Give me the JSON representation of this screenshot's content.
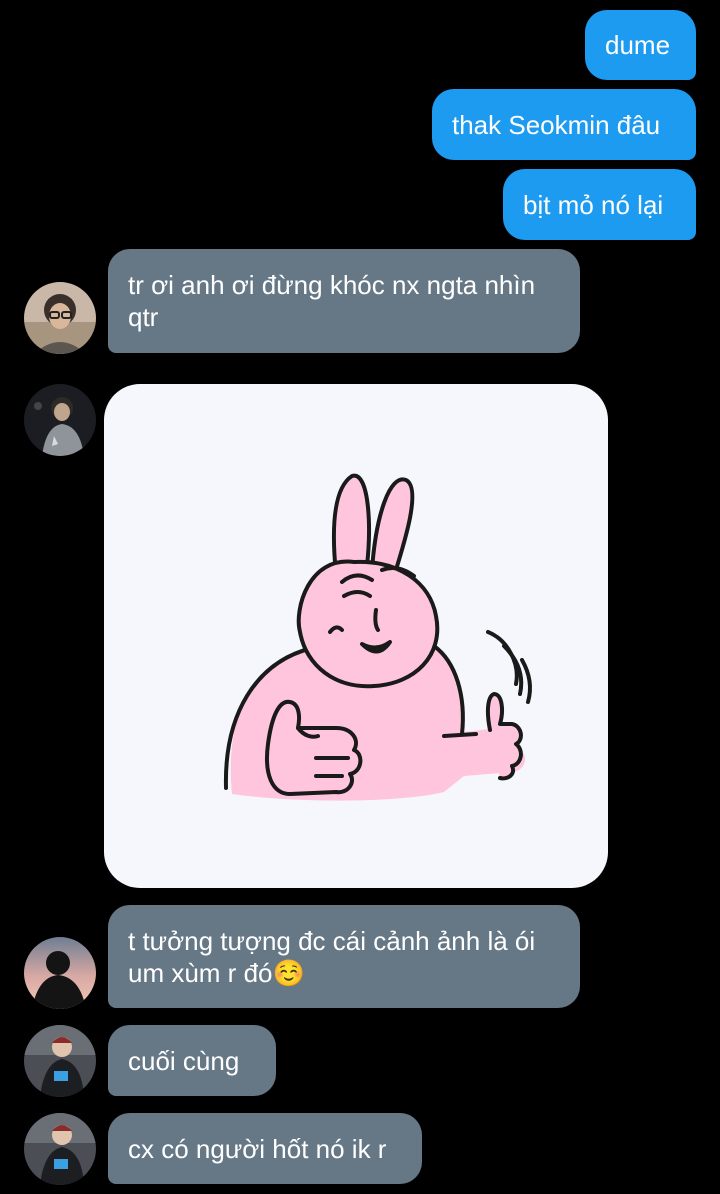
{
  "messages": {
    "sent": [
      {
        "text": "dume"
      },
      {
        "text": "thak Seokmin đâu"
      },
      {
        "text": "bịt mỏ nó lại"
      }
    ],
    "received": [
      {
        "text": "tr ơi anh ơi đừng khóc nx ngta nhìn qtr"
      },
      {
        "text": "t tưởng tượng đc cái cảnh ảnh là ói um xùm r đó☺️"
      },
      {
        "text": "cuối cùng"
      },
      {
        "text": "cx có người hốt nó ik r"
      }
    ]
  },
  "sticker": {
    "icon": "pink-rabbit-thumbs-up-sticker"
  },
  "colors": {
    "background": "#000000",
    "sent_bubble": "#1d9bf0",
    "received_bubble": "#667786",
    "sticker_background": "#f5f7fc",
    "rabbit": "#ffc5dc"
  }
}
